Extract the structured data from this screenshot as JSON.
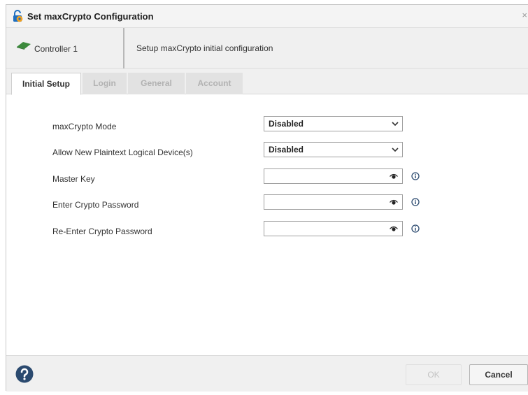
{
  "dialog": {
    "title": "Set maxCrypto Configuration",
    "close_glyph": "×",
    "title_icon": "lock-gear-icon"
  },
  "infobar": {
    "controller_label": "Controller 1",
    "controller_icon": "controller-card-icon",
    "description": "Setup maxCrypto initial configuration"
  },
  "tabs": [
    {
      "label": "Initial Setup",
      "active": true
    },
    {
      "label": "Login",
      "active": false
    },
    {
      "label": "General",
      "active": false
    },
    {
      "label": "Account",
      "active": false
    }
  ],
  "form": {
    "mode": {
      "label": "maxCrypto Mode",
      "value": "Disabled"
    },
    "plaintext": {
      "label": "Allow New Plaintext Logical Device(s)",
      "value": "Disabled"
    },
    "master_key": {
      "label": "Master Key",
      "value": ""
    },
    "password": {
      "label": "Enter Crypto Password",
      "value": ""
    },
    "reenter_password": {
      "label": "Re-Enter Crypto Password",
      "value": ""
    }
  },
  "footer": {
    "help_icon": "help-question-icon",
    "ok_label": "OK",
    "cancel_label": "Cancel"
  },
  "colors": {
    "help_icon": "#2b4a6f",
    "controller_icon": "#3c8a3c",
    "title_icon_lock": "#1f6fc0",
    "title_icon_gear": "#f0a020"
  }
}
